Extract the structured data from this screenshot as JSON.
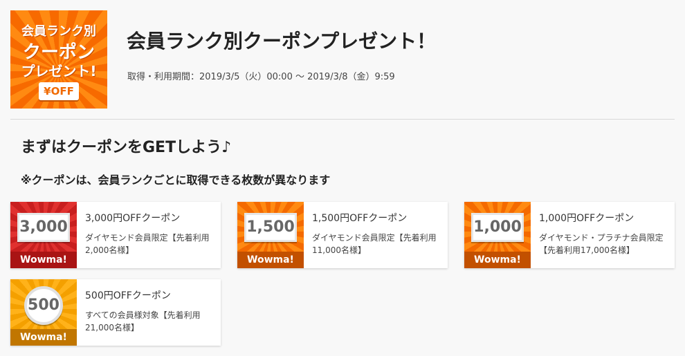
{
  "banner": {
    "line1": "会員ランク別",
    "line2": "クーポン",
    "line3": "プレゼント!",
    "badge": "¥OFF"
  },
  "header": {
    "title": "会員ランク別クーポンプレゼント！",
    "period": "取得・利用期間：2019/3/5（火）00:00 〜 2019/3/8（金）9:59"
  },
  "section": {
    "title": "まずはクーポンをGETしよう♪",
    "note": "※クーポンは、会員ランクごとに取得できる枚数が異なります"
  },
  "coupons": [
    {
      "amount": "3,000",
      "brand": "Wowma!",
      "name": "3,000円OFFクーポン",
      "desc": "ダイヤモンド会員限定【先着利用2,000名様】",
      "color": "#c81f1f"
    },
    {
      "amount": "1,500",
      "brand": "Wowma!",
      "name": "1,500円OFFクーポン",
      "desc": "ダイヤモンド会員限定【先着利用11,000名様】",
      "color": "#f46a00"
    },
    {
      "amount": "1,000",
      "brand": "Wowma!",
      "name": "1,000円OFFクーポン",
      "desc": "ダイヤモンド・プラチナ会員限定【先着利用17,000名様】",
      "color": "#f46a00"
    },
    {
      "amount": "500",
      "brand": "Wowma!",
      "name": "500円OFFクーポン",
      "desc": "すべての会員様対象【先着利用21,000名様】",
      "color": "#f4a000"
    }
  ]
}
